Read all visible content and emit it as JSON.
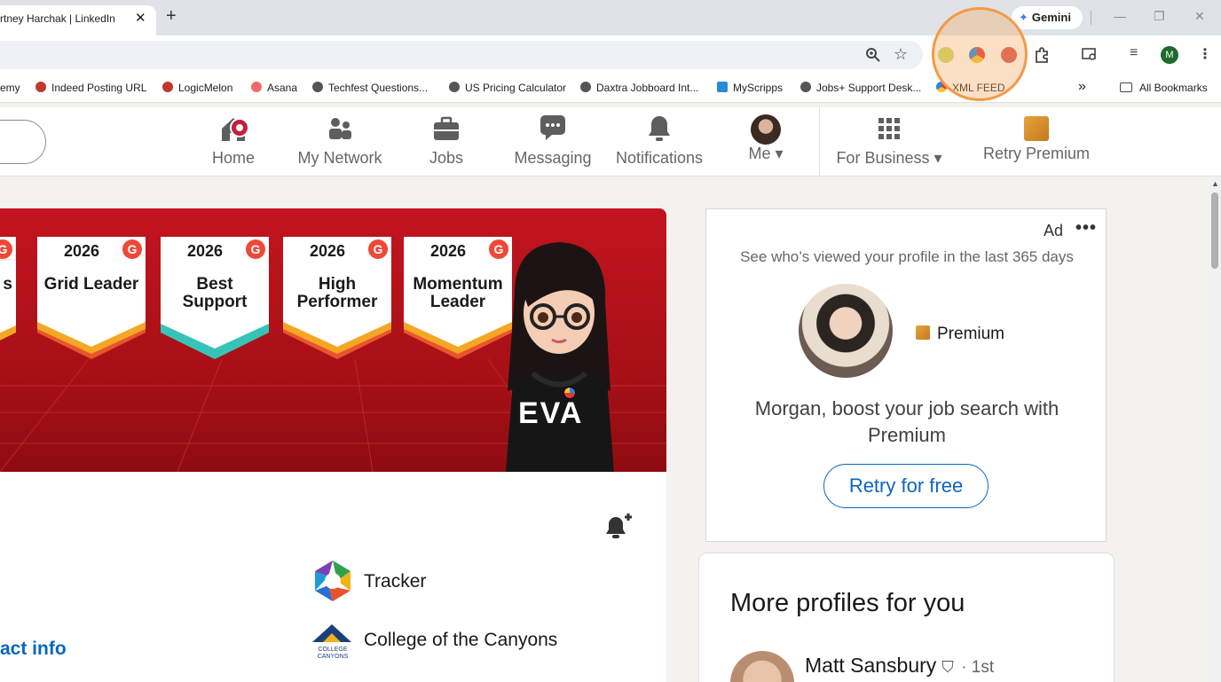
{
  "browser": {
    "tab_title": "rtney Harchak | LinkedIn",
    "tab_close": "✕",
    "new_tab": "+",
    "gemini_label": "Gemini",
    "window_controls": [
      "—",
      "❐",
      "✕"
    ]
  },
  "bookmarks": [
    {
      "label": "emy",
      "icon": "bookmark-icon"
    },
    {
      "label": "Indeed Posting URL",
      "icon": "indeed-icon"
    },
    {
      "label": "LogicMelon",
      "icon": "logicmelon-icon"
    },
    {
      "label": "Asana",
      "icon": "asana-icon"
    },
    {
      "label": "Techfest Questions...",
      "icon": "globe-icon"
    },
    {
      "label": "US Pricing Calculator",
      "icon": "globe-icon"
    },
    {
      "label": "Daxtra Jobboard Int...",
      "icon": "globe-icon"
    },
    {
      "label": "MyScripps",
      "icon": "myscripps-icon"
    },
    {
      "label": "Jobs+ Support Desk...",
      "icon": "globe-icon"
    },
    {
      "label": "XML FEED",
      "icon": "xml-feed-icon"
    }
  ],
  "bookmarks_overflow": "»",
  "all_bookmarks": "All Bookmarks",
  "nav": {
    "items": [
      {
        "label": "Home",
        "icon": "home-icon"
      },
      {
        "label": "My Network",
        "icon": "network-icon"
      },
      {
        "label": "Jobs",
        "icon": "briefcase-icon"
      },
      {
        "label": "Messaging",
        "icon": "messaging-icon"
      },
      {
        "label": "Notifications",
        "icon": "bell-icon"
      },
      {
        "label": "Me",
        "icon": "avatar"
      },
      {
        "label": "For Business",
        "icon": "grid-icon"
      },
      {
        "label": "Retry Premium",
        "icon": "premium-icon"
      }
    ],
    "dropdown_caret": "▾"
  },
  "banner": {
    "badges": [
      {
        "year": "2026",
        "title": "s"
      },
      {
        "year": "2026",
        "title": "Grid Leader"
      },
      {
        "year": "2026",
        "title": "Best Support"
      },
      {
        "year": "2026",
        "title": "High Performer"
      },
      {
        "year": "2026",
        "title": "Momentum Leader"
      }
    ],
    "g2_mark": "G",
    "mascot_text": "EVA"
  },
  "profile": {
    "companies": [
      "Tracker",
      "College of the Canyons"
    ],
    "college_logo_text": "COLLEGE CANYONS",
    "contact_link": "act info"
  },
  "ad": {
    "label": "Ad",
    "more": "•••",
    "headline": "See who’s viewed your profile in the last 365 days",
    "premium_label": "Premium",
    "body": "Morgan, boost your job search with Premium",
    "button": "Retry for free"
  },
  "more_profiles": {
    "title": "More profiles for you",
    "people": [
      {
        "name": "Matt Sansbury",
        "degree": "· 1st"
      }
    ]
  },
  "toolbar": {
    "avatar_letter": "M"
  },
  "colors": {
    "linkedin_blue": "#0a66c2",
    "notification_red": "#c31f3b",
    "banner_red": "#c3141f",
    "premium_gold": "#e7a33a",
    "highlight_orange": "#f29a46"
  }
}
